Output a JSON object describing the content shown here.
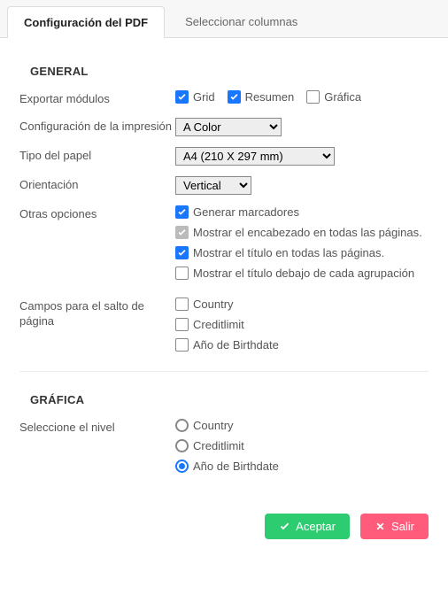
{
  "tabs": {
    "config": "Configuración del PDF",
    "columns": "Seleccionar columnas"
  },
  "general": {
    "title": "GENERAL",
    "export_modules": {
      "label": "Exportar módulos",
      "grid": "Grid",
      "summary": "Resumen",
      "chart": "Gráfica"
    },
    "print_config": {
      "label": "Configuración de la impresión",
      "value": "A Color"
    },
    "paper_type": {
      "label": "Tipo del papel",
      "value": "A4 (210 X 297 mm)"
    },
    "orientation": {
      "label": "Orientación",
      "value": "Vertical"
    },
    "other_options": {
      "label": "Otras opciones",
      "gen_markers": "Generar marcadores",
      "header_all": "Mostrar el encabezado en todas las páginas.",
      "title_all": "Mostrar el título en todas las páginas.",
      "title_below_group": "Mostrar el título debajo de cada agrupación"
    },
    "page_break_fields": {
      "label": "Campos para el salto de página",
      "country": "Country",
      "creditlimit": "Creditlimit",
      "birthdate": "Año de Birthdate"
    }
  },
  "chart": {
    "title": "GRÁFICA",
    "select_level": {
      "label": "Seleccione el nivel",
      "country": "Country",
      "creditlimit": "Creditlimit",
      "birthdate": "Año de Birthdate"
    }
  },
  "footer": {
    "accept": "Aceptar",
    "exit": "Salir"
  }
}
